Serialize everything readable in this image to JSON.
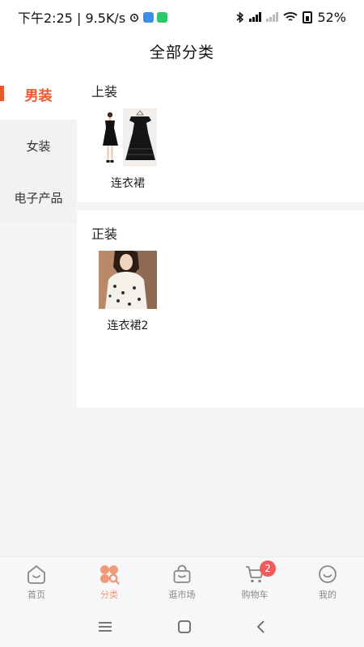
{
  "status_bar": {
    "time_speed": "下午2:25 | 9.5K/s",
    "battery": "52%"
  },
  "header": {
    "title": "全部分类"
  },
  "sidebar": {
    "items": [
      {
        "label": "男装",
        "active": true
      },
      {
        "label": "女装",
        "active": false
      },
      {
        "label": "电子产品",
        "active": false
      }
    ]
  },
  "sections": [
    {
      "title": "上装",
      "items": [
        {
          "name": "连衣裙"
        }
      ]
    },
    {
      "title": "正装",
      "items": [
        {
          "name": "连衣裙2"
        }
      ]
    }
  ],
  "tabbar": {
    "tabs": [
      {
        "label": "首页",
        "icon": "home-icon"
      },
      {
        "label": "分类",
        "icon": "category-icon",
        "active": true
      },
      {
        "label": "逛市场",
        "icon": "bag-icon"
      },
      {
        "label": "购物车",
        "icon": "cart-icon",
        "badge": "2"
      },
      {
        "label": "我的",
        "icon": "profile-icon"
      }
    ]
  },
  "colors": {
    "accent": "#e8592d",
    "tab_active": "#f09a7a",
    "badge": "#f05b5b"
  }
}
